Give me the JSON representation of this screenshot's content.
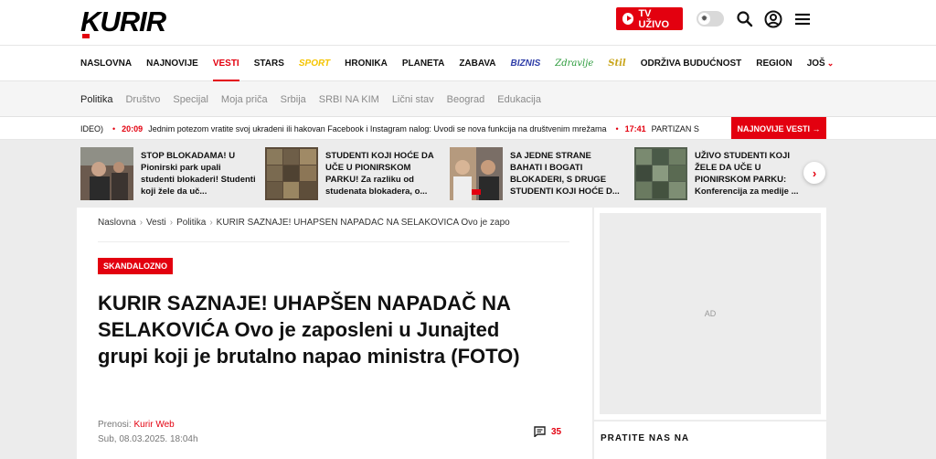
{
  "header": {
    "logo_text": "KURIR",
    "tv_label": "TV UŽIVO",
    "brand_color": "#e3000f"
  },
  "main_nav": {
    "items": [
      {
        "label": "NASLOVNA",
        "style": "default"
      },
      {
        "label": "NAJNOVIJE",
        "style": "default"
      },
      {
        "label": "VESTI",
        "style": "active"
      },
      {
        "label": "STARS",
        "style": "default"
      },
      {
        "label": "SPORT",
        "style": "sport"
      },
      {
        "label": "HRONIKA",
        "style": "default"
      },
      {
        "label": "PLANETA",
        "style": "default"
      },
      {
        "label": "ZABAVA",
        "style": "default"
      },
      {
        "label": "BIZNIS",
        "style": "biznis"
      },
      {
        "label": "Zdravlje",
        "style": "zdravlje"
      },
      {
        "label": "Stil",
        "style": "stil"
      },
      {
        "label": "ODRŽIVA BUDUĆNOST",
        "style": "default"
      },
      {
        "label": "REGION",
        "style": "default"
      },
      {
        "label": "JOŠ",
        "style": "more"
      }
    ]
  },
  "sub_nav": {
    "items": [
      {
        "label": "Politika",
        "active": true
      },
      {
        "label": "Društvo",
        "active": false
      },
      {
        "label": "Specijal",
        "active": false
      },
      {
        "label": "Moja priča",
        "active": false
      },
      {
        "label": "Srbija",
        "active": false
      },
      {
        "label": "SRBI NA KIM",
        "active": false
      },
      {
        "label": "Lični stav",
        "active": false
      },
      {
        "label": "Beograd",
        "active": false
      },
      {
        "label": "Edukacija",
        "active": false
      }
    ]
  },
  "ticker": {
    "lead_fragment": "IDEO)",
    "items": [
      {
        "time": "20:09",
        "text": "Jednim potezom vratite svoj ukradeni ili hakovan Facebook i Instagram nalog: Uvodi se nova funkcija na društvenim mrežama"
      },
      {
        "time": "17:41",
        "text": "PARTIZAN S"
      }
    ],
    "button_label": "NAJNOVIJE VESTI →"
  },
  "cards": [
    {
      "title": "STOP BLOKADAMA! U Pionirski park upali studenti blokaderi! Studenti koji žele da uč..."
    },
    {
      "title": "STUDENTI KOJI HOĆE DA UČE U PIONIRSKOM PARKU! Za razliku od studenata blokadera, o..."
    },
    {
      "title": "SA JEDNE STRANE BAHATI I BOGATI BLOKADERI, S DRUGE STUDENTI KOJI HOĆE D..."
    },
    {
      "title": "UŽIVO STUDENTI KOJI ŽELE DA UČE U PIONIRSKOM PARKU: Konferencija za medije ..."
    }
  ],
  "article": {
    "breadcrumb": [
      "Naslovna",
      "Vesti",
      "Politika",
      "KURIR SAZNAJE! UHAPŠEN NAPADAČ NA SELAKOVIĆA Ovo je zapo"
    ],
    "tag": "SKANDALOZNO",
    "headline": "KURIR SAZNAJE! UHAPŠEN NAPADAČ NA SELAKOVIĆA Ovo je zaposleni u Junajted grupi koji je brutalno napao ministra (FOTO)",
    "source_label": "Prenosi: ",
    "source_name": "Kurir Web",
    "date": "Sub, 08.03.2025. 18:04h",
    "comment_count": "35"
  },
  "sidebar": {
    "ad_label": "AD",
    "follow_label": "PRATITE NAS NA"
  }
}
